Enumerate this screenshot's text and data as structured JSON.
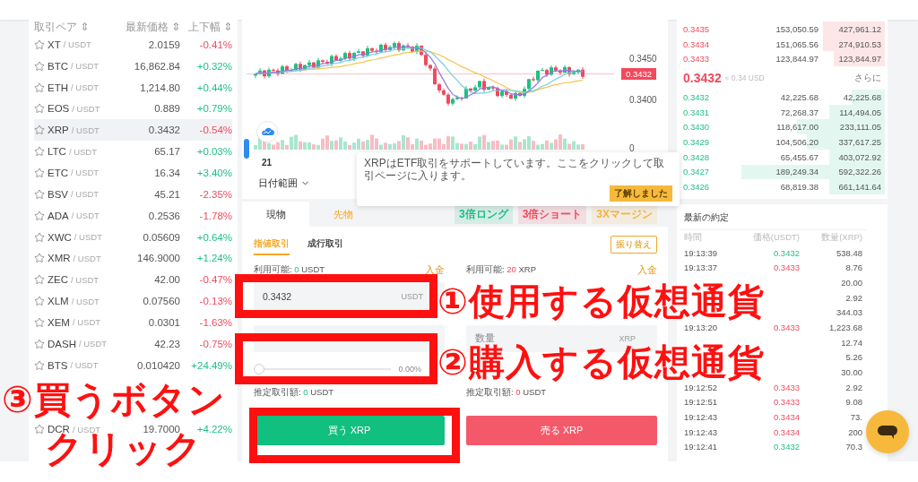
{
  "markets": {
    "columns": [
      "取引ペア ⇕",
      "最新価格 ⇕",
      "上下幅 ⇕"
    ],
    "rows": [
      {
        "kind": "pair",
        "base": "XT",
        "quote": "/ USDT",
        "price": "2.0159",
        "change": "-0.41%",
        "rising": false,
        "selected": false
      },
      {
        "kind": "pair",
        "base": "BTC",
        "quote": "/ USDT",
        "price": "16,862.84",
        "change": "+0.32%",
        "rising": true,
        "selected": false
      },
      {
        "kind": "pair",
        "base": "ETH",
        "quote": "/ USDT",
        "price": "1,214.80",
        "change": "+0.44%",
        "rising": true,
        "selected": false
      },
      {
        "kind": "pair",
        "base": "EOS",
        "quote": "/ USDT",
        "price": "0.889",
        "change": "+0.79%",
        "rising": true,
        "selected": false
      },
      {
        "kind": "pair",
        "base": "XRP",
        "quote": "/ USDT",
        "price": "0.3432",
        "change": "-0.54%",
        "rising": false,
        "selected": true
      },
      {
        "kind": "pair",
        "base": "LTC",
        "quote": "/ USDT",
        "price": "65.17",
        "change": "+0.03%",
        "rising": true,
        "selected": false
      },
      {
        "kind": "pair",
        "base": "ETC",
        "quote": "/ USDT",
        "price": "16.34",
        "change": "+3.40%",
        "rising": true,
        "selected": false
      },
      {
        "kind": "pair",
        "base": "BSV",
        "quote": "/ USDT",
        "price": "45.21",
        "change": "-2.35%",
        "rising": false,
        "selected": false
      },
      {
        "kind": "pair",
        "base": "ADA",
        "quote": "/ USDT",
        "price": "0.2536",
        "change": "-1.78%",
        "rising": false,
        "selected": false
      },
      {
        "kind": "pair",
        "base": "XWC",
        "quote": "/ USDT",
        "price": "0.05609",
        "change": "+0.64%",
        "rising": true,
        "selected": false
      },
      {
        "kind": "pair",
        "base": "XMR",
        "quote": "/ USDT",
        "price": "146.9000",
        "change": "+1.24%",
        "rising": true,
        "selected": false
      },
      {
        "kind": "pair",
        "base": "ZEC",
        "quote": "/ USDT",
        "price": "42.00",
        "change": "-0.47%",
        "rising": false,
        "selected": false
      },
      {
        "kind": "pair",
        "base": "XLM",
        "quote": "/ USDT",
        "price": "0.07560",
        "change": "-0.13%",
        "rising": false,
        "selected": false
      },
      {
        "kind": "pair",
        "base": "XEM",
        "quote": "/ USDT",
        "price": "0.0301",
        "change": "-1.63%",
        "rising": false,
        "selected": false
      },
      {
        "kind": "pair",
        "base": "DASH",
        "quote": "/ USDT",
        "price": "42.23",
        "change": "-0.75%",
        "rising": false,
        "selected": false
      },
      {
        "kind": "pair",
        "base": "BTS",
        "quote": "/ USDT",
        "price": "0.010420",
        "change": "+24.49%",
        "rising": true,
        "selected": false
      },
      {
        "kind": "covered"
      },
      {
        "kind": "covered"
      },
      {
        "kind": "pair",
        "base": "DCR",
        "quote": "/ USDT",
        "price": "19.7000",
        "change": "+4.22%",
        "rising": true,
        "selected": false
      },
      {
        "kind": "covered"
      }
    ]
  },
  "chart": {
    "axis": [
      "0.3450",
      "0.3400",
      "0"
    ],
    "last_price": "0.3432",
    "time_label": "21",
    "range_button": "日付範囲"
  },
  "notice": {
    "text": "XRPはETF取引をサポートしています。ここをクリックして取引ページに入ります。",
    "button": "了解しました"
  },
  "order": {
    "tabs": [
      {
        "label": "現物",
        "selected": true
      },
      {
        "label": "先物",
        "selected": false
      }
    ],
    "tags": [
      {
        "label": "3倍ロング",
        "color": "#1fbf83"
      },
      {
        "label": "3倍ショート",
        "color": "#f04a5d"
      },
      {
        "label": "3Xマージン",
        "color": "#f5b342"
      }
    ],
    "subtabs": [
      {
        "label": "指値取引",
        "selected": true
      },
      {
        "label": "成行取引",
        "selected": false
      }
    ],
    "transfer": "振り替え",
    "buy": {
      "available_label": "利用可能:",
      "available": "0",
      "available_unit": "USDT",
      "deposit": "入金",
      "price": "0.3432",
      "price_unit": "USDT",
      "slider": {
        "level": 0
      },
      "percent": "0.00%",
      "estimate_label": "推定取引額:",
      "estimate": "0",
      "estimate_unit": "USDT",
      "button": "買う XRP"
    },
    "sell": {
      "available_label": "利用可能:",
      "available": "20",
      "available_unit": "XRP",
      "deposit": "入金",
      "quantity_placeholder": "数量",
      "quantity_unit": "XRP",
      "estimate_label": "推定取引額:",
      "estimate": "0",
      "estimate_unit": "USDT",
      "button": "売る XRP"
    }
  },
  "order_book": {
    "asks": [
      {
        "price": "0.3435",
        "amount": "153,050.59",
        "total": "427,961.12",
        "level": 0.3
      },
      {
        "price": "0.3434",
        "amount": "151,065.56",
        "total": "274,910.53",
        "level": 0.3
      },
      {
        "price": "0.3433",
        "amount": "123,844.97",
        "total": "123,844.97",
        "level": 0.25
      }
    ],
    "mid": {
      "price": "0.3432",
      "usd": "≈ 0.34 USD",
      "more": "さらに"
    },
    "bids": [
      {
        "price": "0.3432",
        "amount": "42,225.68",
        "total": "42,225.68",
        "level": 0.16
      },
      {
        "price": "0.3431",
        "amount": "72,268.37",
        "total": "114,494.05",
        "level": 0.27
      },
      {
        "price": "0.3430",
        "amount": "118,617.00",
        "total": "233,111.05",
        "level": 0.43
      },
      {
        "price": "0.3429",
        "amount": "104,506.20",
        "total": "337,617.25",
        "level": 0.38
      },
      {
        "price": "0.3428",
        "amount": "65,455.67",
        "total": "403,072.92",
        "level": 0.27
      },
      {
        "price": "0.3427",
        "amount": "189,249.34",
        "total": "592,322.26",
        "level": 0.7
      },
      {
        "price": "0.3426",
        "amount": "68,819.38",
        "total": "661,141.64",
        "level": 0.27
      }
    ]
  },
  "trades": {
    "title": "最新の約定",
    "columns": [
      "時間",
      "価格(USDT)",
      "数量(XRP)"
    ],
    "rows": [
      {
        "time": "19:13:39",
        "price": "0.3432",
        "buy": true,
        "qty": "538.48"
      },
      {
        "time": "19:13:37",
        "price": "0.3433",
        "buy": false,
        "qty": "8.76"
      },
      {
        "qty": "20.00"
      },
      {
        "qty": "2.92"
      },
      {
        "qty": "344.03"
      },
      {
        "time": "19:13:20",
        "price": "0.3433",
        "buy": false,
        "qty": "1,223.68"
      },
      {
        "qty": "12.74"
      },
      {
        "qty": "5.26"
      },
      {
        "qty": "30.00"
      },
      {
        "time": "19:12:52",
        "price": "0.3433",
        "buy": false,
        "qty": "2.92"
      },
      {
        "time": "19:12:51",
        "price": "0.3433",
        "buy": false,
        "qty": "9.08"
      },
      {
        "time": "19:12:43",
        "price": "0.3434",
        "buy": false,
        "qty": "73."
      },
      {
        "time": "19:12:43",
        "price": "0.3434",
        "buy": false,
        "qty": "200"
      },
      {
        "time": "19:12:41",
        "price": "0.3432",
        "buy": true,
        "qty": "70.3"
      }
    ]
  },
  "annotations": [
    {
      "kind": "box"
    },
    {
      "kind": "box"
    },
    {
      "kind": "box"
    },
    {
      "kind": "note",
      "text": "①使用する仮想通貨"
    },
    {
      "kind": "note",
      "text": "②購入する仮想通貨"
    },
    {
      "kind": "note",
      "text": "③買うボタン"
    },
    {
      "kind": "note",
      "text": "クリック"
    }
  ]
}
